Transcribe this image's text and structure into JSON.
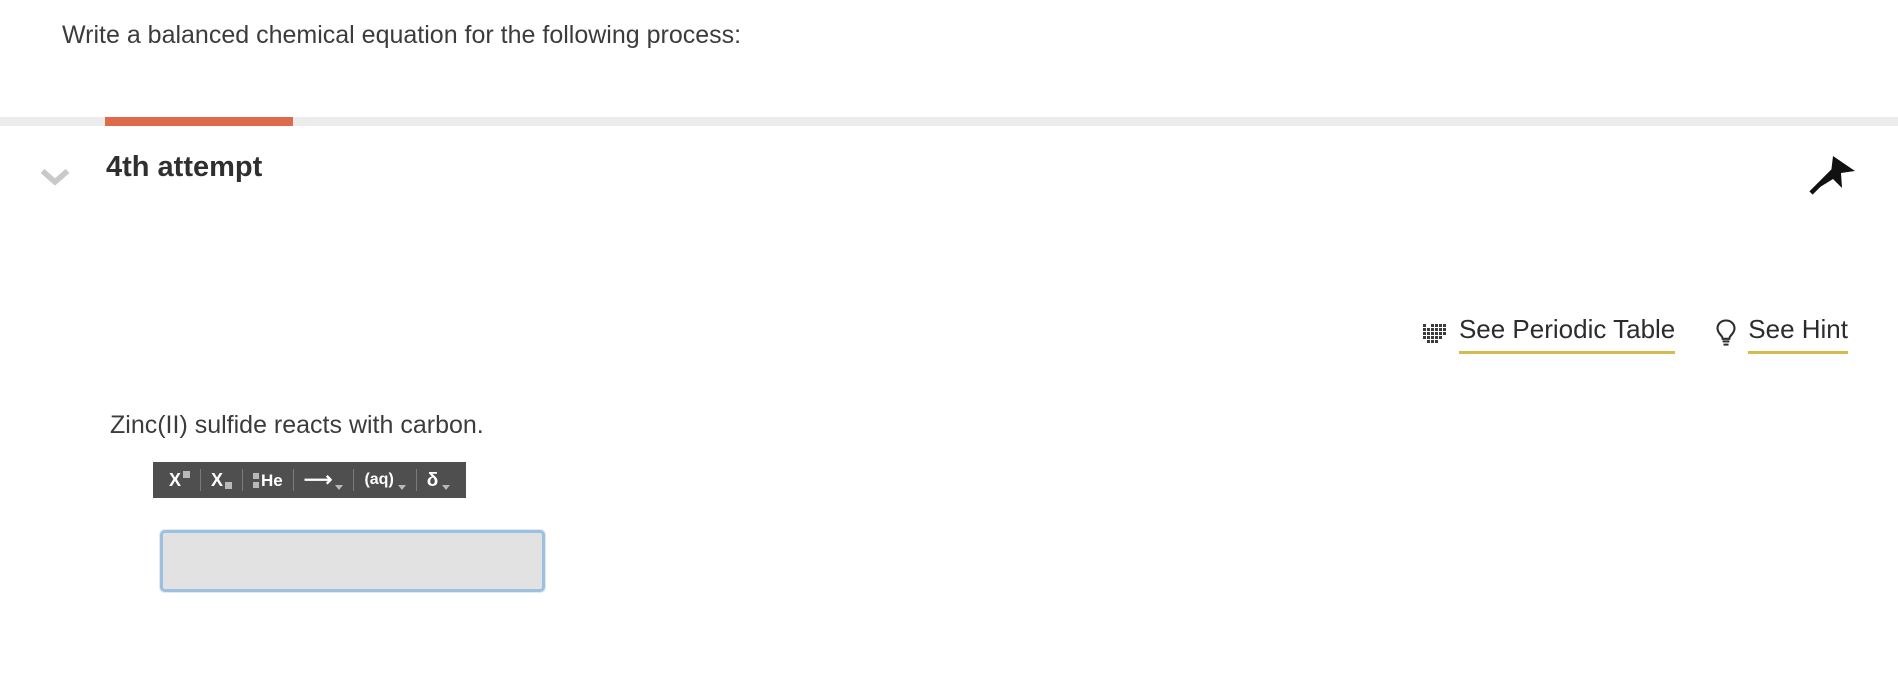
{
  "prompt": {
    "text": "Write a balanced chemical equation for the following process:"
  },
  "progress": {
    "fill_color": "#dd6b4b",
    "track_color": "#ececec"
  },
  "attempt": {
    "title": "4th attempt",
    "collapse_icon": "chevron-down-icon",
    "flag_icon": "flag-icon"
  },
  "tools": {
    "periodic_table": {
      "label": "See Periodic Table",
      "icon": "periodic-table-icon"
    },
    "hint": {
      "label": "See Hint",
      "icon": "lightbulb-icon"
    },
    "underline_color": "#d6b94f"
  },
  "question": {
    "text": "Zinc(II) sulfide reacts with carbon."
  },
  "toolbar": {
    "buttons": [
      {
        "name": "superscript-button",
        "label": "X",
        "kind": "superscript"
      },
      {
        "name": "subscript-button",
        "label": "X",
        "kind": "subscript"
      },
      {
        "name": "isotope-button",
        "label": "He",
        "kind": "isotope"
      },
      {
        "name": "reaction-arrow-button",
        "label": "⟶",
        "kind": "arrow-dropdown"
      },
      {
        "name": "state-of-matter-button",
        "label": "(aq)",
        "kind": "aq-dropdown"
      },
      {
        "name": "partial-charge-button",
        "label": "δ",
        "kind": "delta-dropdown"
      }
    ],
    "background": "#4f4f4f"
  },
  "answer": {
    "value": "",
    "placeholder": "",
    "border_color": "#9dc0de",
    "background": "#e2e2e2"
  }
}
